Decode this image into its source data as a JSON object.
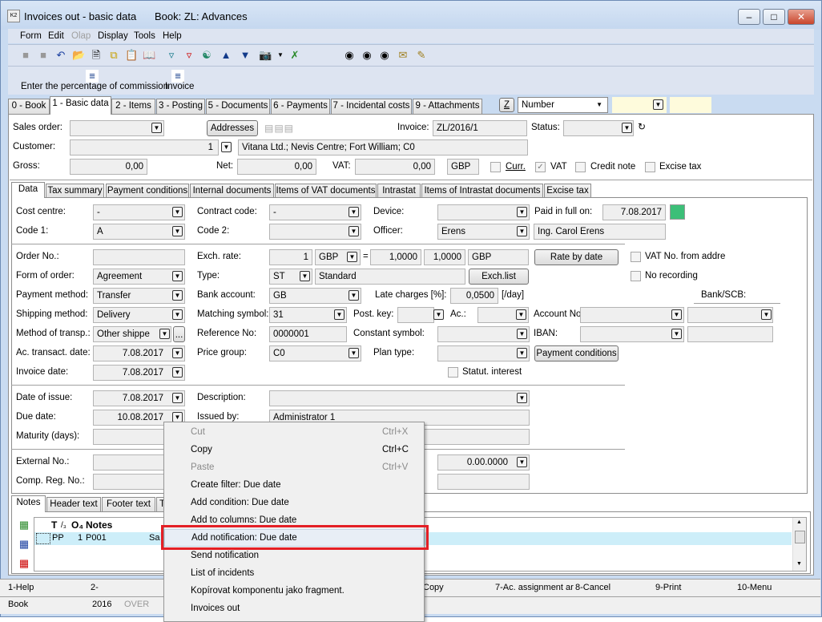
{
  "window": {
    "title": "Invoices out - basic data",
    "book": "Book: ZL: Advances",
    "controls": [
      "–",
      "□",
      "✕"
    ]
  },
  "menu": [
    "Form",
    "Edit",
    "Olap",
    "Display",
    "Tools",
    "Help"
  ],
  "toolbar2": {
    "commission": "Enter the percentage of commission",
    "invoice": "Invoice"
  },
  "tabs": [
    "0 - Book",
    "1 - Basic data",
    "2 - Items",
    "3 - Posting",
    "5 - Documents",
    "6 - Payments",
    "7 - Incidental costs",
    "9 - Attachments"
  ],
  "sort": {
    "z": "Z",
    "field": "Number"
  },
  "header": {
    "sales_order": "Sales order:",
    "addresses": "Addresses",
    "invoice_label": "Invoice:",
    "invoice": "ZL/2016/1",
    "status_label": "Status:",
    "customer_label": "Customer:",
    "customer_no": "1",
    "customer": "Vitana Ltd.; Nevis Centre; Fort William; C0",
    "gross_label": "Gross:",
    "gross": "0,00",
    "net_label": "Net:",
    "net": "0,00",
    "vat_label": "VAT:",
    "vat": "0,00",
    "currency": "GBP",
    "curr": "Curr.",
    "vat_cb": "VAT",
    "credit_note": "Credit note",
    "excise": "Excise tax"
  },
  "subtabs": [
    "Data",
    "Tax summary",
    "Payment conditions",
    "Internal documents",
    "Items of VAT documents",
    "Intrastat",
    "Items of Intrastat documents",
    "Excise tax"
  ],
  "data": {
    "cost_centre": "Cost centre:",
    "cost_centre_v": "-",
    "contract_code": "Contract code:",
    "contract_code_v": "-",
    "device": "Device:",
    "paid_full": "Paid in full on:",
    "paid_full_v": "7.08.2017",
    "paid_color": "#3cbf78",
    "code1": "Code 1:",
    "code1_v": "A",
    "code2": "Code 2:",
    "officer": "Officer:",
    "officer_v": "Erens",
    "officer_name": "Ing. Carol Erens",
    "order_no": "Order No.:",
    "exch_rate": "Exch. rate:",
    "exch_amt": "1",
    "exch_cur": "GBP",
    "eq": "=",
    "rate1": "1,0000",
    "rate2": "1,0000",
    "rate_cur": "GBP",
    "rate_by_date": "Rate by date",
    "vat_no_addr": "VAT No. from addre",
    "form_order": "Form of order:",
    "form_order_v": "Agreement",
    "type": "Type:",
    "type_v": "ST",
    "type_name": "Standard",
    "exch_list": "Exch.list",
    "no_recording": "No recording",
    "payment_method": "Payment method:",
    "payment_method_v": "Transfer",
    "bank_account": "Bank account:",
    "bank_account_v": "GB",
    "late_charges": "Late charges [%]:",
    "late_charges_v": "0,0500",
    "per_day": "[/day]",
    "bank_scb": "Bank/SCB:",
    "shipping": "Shipping method:",
    "shipping_v": "Delivery",
    "matching": "Matching symbol:",
    "matching_v": "31",
    "post_key": "Post. key:",
    "ac": "Ac.:",
    "account_no": "Account No.",
    "transp": "Method of transp.:",
    "transp_v": "Other shippe",
    "ellipsis": "...",
    "ref_no": "Reference No:",
    "ref_no_v": "0000001",
    "const_sym": "Constant symbol:",
    "iban": "IBAN:",
    "ac_date": "Ac. transact. date:",
    "ac_date_v": "7.08.2017",
    "price_group": "Price group:",
    "price_group_v": "C0",
    "plan_type": "Plan type:",
    "payment_conditions": "Payment conditions",
    "invoice_date": "Invoice date:",
    "invoice_date_v": "7.08.2017",
    "statut": "Statut. interest",
    "date_issue": "Date of issue:",
    "date_issue_v": "7.08.2017",
    "description": "Description:",
    "due_date": "Due date:",
    "due_date_v": "10.08.2017",
    "issued_by": "Issued by:",
    "issued_by_v": "Administrator 1",
    "maturity": "Maturity (days):",
    "external": "External No.:",
    "ext_date": "0.00.0000",
    "comp_reg": "Comp. Reg. No.:"
  },
  "bottom_tabs": [
    "Notes",
    "Header text",
    "Footer text",
    "T"
  ],
  "notes": {
    "col_t": "T",
    "col_3": "/₃",
    "col_o": "O₄",
    "col_notes": "Notes",
    "row": {
      "t": "PP",
      "n": "1",
      "code": "P001",
      "text": "Sa"
    }
  },
  "status": {
    "f1": "1-Help",
    "f2": "2-",
    "f6": "Copy",
    "f7": "7-Ac. assignment ar",
    "f8": "8-Cancel",
    "f9": "9-Print",
    "f10": "10-Menu",
    "book": "Book",
    "year": "2016",
    "over": "OVER"
  },
  "context_menu": [
    {
      "label": "Cut",
      "shortcut": "Ctrl+X",
      "disabled": true
    },
    {
      "label": "Copy",
      "shortcut": "Ctrl+C"
    },
    {
      "label": "Paste",
      "shortcut": "Ctrl+V",
      "disabled": true
    },
    {
      "label": "Create filter: Due date"
    },
    {
      "label": "Add condition: Due date"
    },
    {
      "label": "Add to columns: Due date"
    },
    {
      "label": "Add notification: Due date",
      "highlighted": true
    },
    {
      "label": "Send notification"
    },
    {
      "label": "List of incidents"
    },
    {
      "label": "Kopírovat komponentu jako fragment."
    },
    {
      "label": "Invoices out"
    }
  ],
  "highlight_color": "#e41f26"
}
